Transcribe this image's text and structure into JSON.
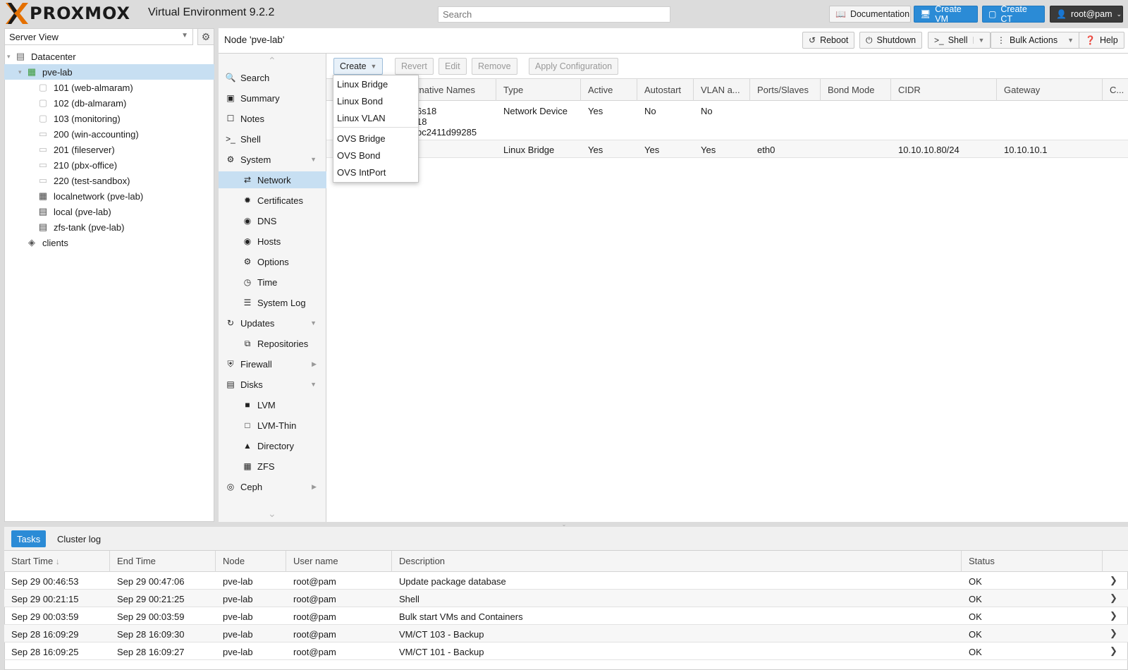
{
  "header": {
    "logo_text": "PROXMOX",
    "version": "Virtual Environment 9.2.2",
    "search_placeholder": "Search",
    "documentation": "Documentation",
    "create_vm": "Create VM",
    "create_ct": "Create CT",
    "user": "root@pam"
  },
  "sidebar": {
    "view": "Server View",
    "tree": [
      {
        "label": "Datacenter",
        "icon": "server-icon"
      },
      {
        "label": "pve-lab",
        "icon": "node-online-icon",
        "selected": true
      },
      {
        "label": "101 (web-almaram)",
        "icon": "container-icon"
      },
      {
        "label": "102 (db-almaram)",
        "icon": "container-icon"
      },
      {
        "label": "103 (monitoring)",
        "icon": "container-icon"
      },
      {
        "label": "200 (win-accounting)",
        "icon": "vm-icon"
      },
      {
        "label": "201 (fileserver)",
        "icon": "vm-icon"
      },
      {
        "label": "210 (pbx-office)",
        "icon": "vm-icon"
      },
      {
        "label": "220 (test-sandbox)",
        "icon": "vm-icon"
      },
      {
        "label": "localnetwork (pve-lab)",
        "icon": "sdn-icon"
      },
      {
        "label": "local (pve-lab)",
        "icon": "storage-icon"
      },
      {
        "label": "zfs-tank (pve-lab)",
        "icon": "storage-icon"
      },
      {
        "label": "clients",
        "icon": "tags-icon"
      }
    ]
  },
  "node": {
    "title": "Node 'pve-lab'",
    "reboot": "Reboot",
    "shutdown": "Shutdown",
    "shell": "Shell",
    "bulk_actions": "Bulk Actions",
    "help": "Help"
  },
  "menu": {
    "search": "Search",
    "summary": "Summary",
    "notes": "Notes",
    "shell": "Shell",
    "system": "System",
    "network": "Network",
    "certificates": "Certificates",
    "dns": "DNS",
    "hosts": "Hosts",
    "options": "Options",
    "time": "Time",
    "system_log": "System Log",
    "updates": "Updates",
    "repositories": "Repositories",
    "firewall": "Firewall",
    "disks": "Disks",
    "lvm": "LVM",
    "lvm_thin": "LVM-Thin",
    "directory": "Directory",
    "zfs": "ZFS",
    "ceph": "Ceph"
  },
  "network": {
    "toolbar": {
      "create": "Create",
      "revert": "Revert",
      "edit": "Edit",
      "remove": "Remove",
      "apply": "Apply Configuration"
    },
    "columns": {
      "alt_names": "ernative Names",
      "type": "Type",
      "active": "Active",
      "autostart": "Autostart",
      "vlan": "VLAN a...",
      "ports": "Ports/Slaves",
      "bond_mode": "Bond Mode",
      "cidr": "CIDR",
      "gateway": "Gateway",
      "comment": "C..."
    },
    "rows": [
      {
        "alt1": "6s18",
        "alt2": "18",
        "alt3": "bc2411d99285",
        "type": "Network Device",
        "active": "Yes",
        "autostart": "No",
        "vlan": "No",
        "ports": "",
        "cidr": "",
        "gateway": ""
      },
      {
        "alt1": "",
        "type": "Linux Bridge",
        "active": "Yes",
        "autostart": "Yes",
        "vlan": "Yes",
        "ports": "eth0",
        "cidr": "10.10.10.80/24",
        "gateway": "10.10.10.1"
      }
    ],
    "create_menu": [
      "Linux Bridge",
      "Linux Bond",
      "Linux VLAN",
      "OVS Bridge",
      "OVS Bond",
      "OVS IntPort"
    ]
  },
  "tasks": {
    "tab_tasks": "Tasks",
    "tab_cluster_log": "Cluster log",
    "columns": {
      "start": "Start Time",
      "end": "End Time",
      "node": "Node",
      "user": "User name",
      "description": "Description",
      "status": "Status"
    },
    "rows": [
      {
        "start": "Sep 29 00:46:53",
        "end": "Sep 29 00:47:06",
        "node": "pve-lab",
        "user": "root@pam",
        "description": "Update package database",
        "status": "OK"
      },
      {
        "start": "Sep 29 00:21:15",
        "end": "Sep 29 00:21:25",
        "node": "pve-lab",
        "user": "root@pam",
        "description": "Shell",
        "status": "OK"
      },
      {
        "start": "Sep 29 00:03:59",
        "end": "Sep 29 00:03:59",
        "node": "pve-lab",
        "user": "root@pam",
        "description": "Bulk start VMs and Containers",
        "status": "OK"
      },
      {
        "start": "Sep 28 16:09:29",
        "end": "Sep 28 16:09:30",
        "node": "pve-lab",
        "user": "root@pam",
        "description": "VM/CT 103 - Backup",
        "status": "OK"
      },
      {
        "start": "Sep 28 16:09:25",
        "end": "Sep 28 16:09:27",
        "node": "pve-lab",
        "user": "root@pam",
        "description": "VM/CT 101 - Backup",
        "status": "OK"
      }
    ]
  },
  "colors": {
    "accent": "#2b8bd6",
    "brand": "#e57000",
    "selection": "#c7dff2"
  }
}
